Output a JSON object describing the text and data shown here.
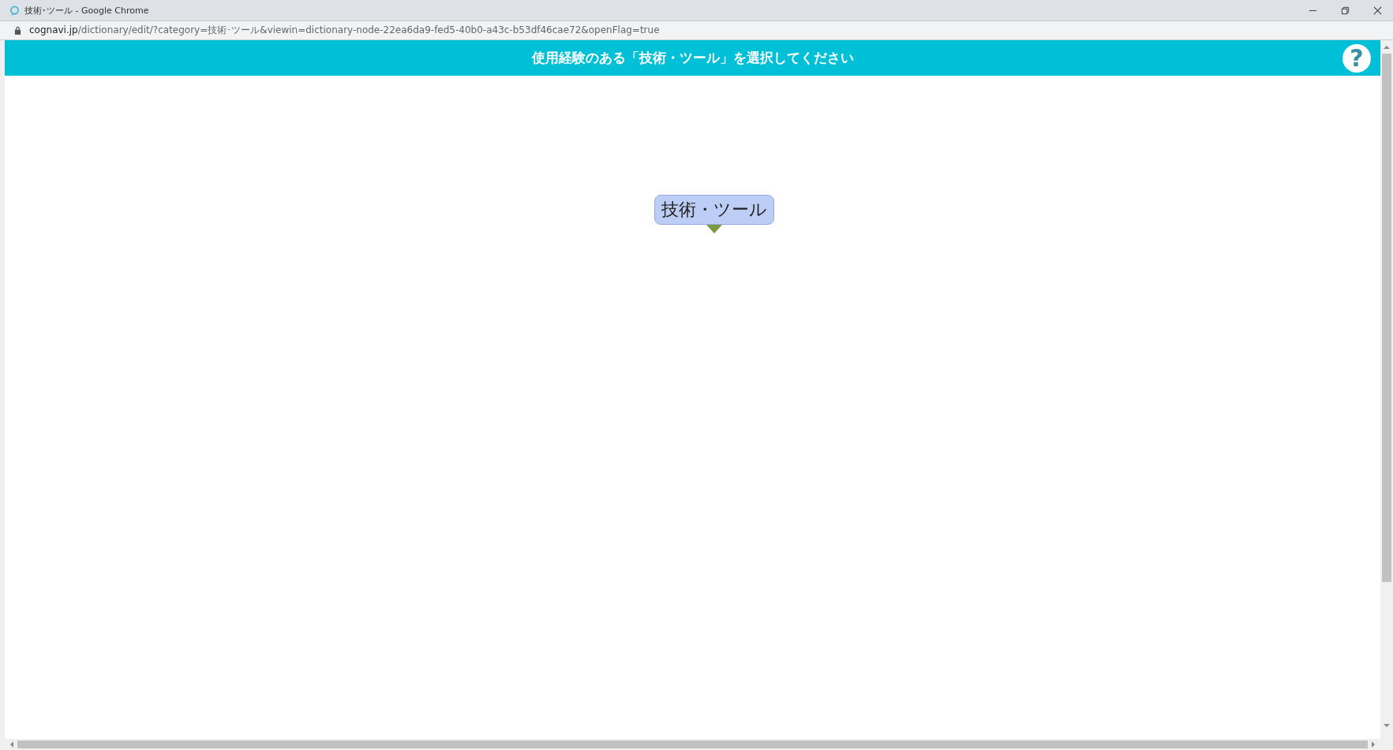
{
  "window": {
    "title": "技術･ツール - Google Chrome"
  },
  "address_bar": {
    "host": "cognavi.jp",
    "path": "/dictionary/edit/?category=技術･ツール&viewin=dictionary-node-22ea6da9-fed5-40b0-a43c-b53df46cae72&openFlag=true"
  },
  "header": {
    "title": "使用経験のある「技術・ツール」を選択してください",
    "help": "?"
  },
  "nodes": [
    {
      "label": "技術・ツール",
      "expanded": false
    }
  ]
}
